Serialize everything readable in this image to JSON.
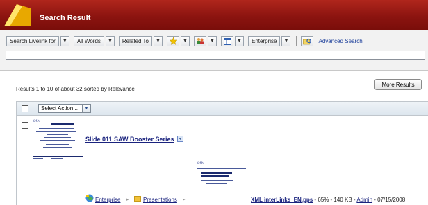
{
  "header": {
    "title": "Search Result",
    "colors": {
      "bar": "#8c1410",
      "logo": "#f5c400"
    }
  },
  "toolbar": {
    "search_scope": "Search Livelink for",
    "words_mode": "All Words",
    "related": "Related To",
    "slice": "Enterprise",
    "advanced_link": "Advanced Search",
    "icons": [
      "star-icon",
      "people-icon",
      "columns-icon",
      "advanced-search-icon"
    ]
  },
  "search": {
    "value": "",
    "placeholder": ""
  },
  "results": {
    "summary": "Results 1 to 10 of about 32 sorted by Relevance",
    "more_button": "More Results"
  },
  "action_bar": {
    "select_action": "Select Action..."
  },
  "result1": {
    "title": "Slide 011 SAW Booster Series",
    "breadcrumb": [
      "Enterprise",
      "Presentations"
    ],
    "file_name": "XML interLinks_EN.pps",
    "relevance": " - 65% - 140 KB - ",
    "author": "Admin",
    "date": " - 07/15/2008"
  },
  "thumbnails": {
    "logo_text": "SAW"
  }
}
